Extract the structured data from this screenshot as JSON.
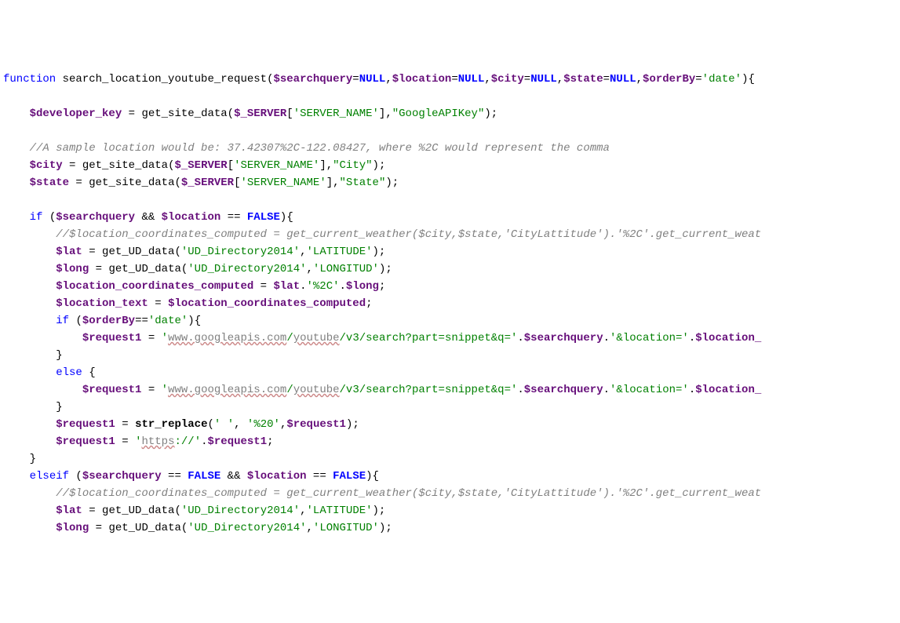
{
  "line1": {
    "kw": "function",
    "fn": " search_location_youtube_request",
    "p1": "(",
    "v1": "$searchquery",
    "eq1": "=",
    "n1": "NULL",
    "c1": ",",
    "v2": "$location",
    "eq2": "=",
    "n2": "NULL",
    "c2": ",",
    "v3": "$city",
    "eq3": "=",
    "n3": "NULL",
    "c3": ",",
    "v4": "$state",
    "eq4": "=",
    "n4": "NULL",
    "c4": ",",
    "v5": "$orderBy",
    "eq5": "=",
    "s": "'date'",
    "p2": "){"
  },
  "line3": {
    "v1": "$developer_key",
    "eq": " = ",
    "fn": "get_site_data",
    "p1": "(",
    "v2": "$_SERVER",
    "br": "[",
    "s1": "'SERVER_NAME'",
    "br2": "],",
    "s2": "\"GoogleAPIKey\"",
    "p2": ");"
  },
  "line5": {
    "c": "//A sample location would be: 37.42307%2C-122.08427, where %2C would represent the comma"
  },
  "line6": {
    "v1": "$city",
    "eq": " = ",
    "fn": "get_site_data",
    "p1": "(",
    "v2": "$_SERVER",
    "br": "[",
    "s1": "'SERVER_NAME'",
    "br2": "],",
    "s2": "\"City\"",
    "p2": ");"
  },
  "line7": {
    "v1": "$state",
    "eq": " = ",
    "fn": "get_site_data",
    "p1": "(",
    "v2": "$_SERVER",
    "br": "[",
    "s1": "'SERVER_NAME'",
    "br2": "],",
    "s2": "\"State\"",
    "p2": ");"
  },
  "line9": {
    "kw": "if ",
    "p1": "(",
    "v1": "$searchquery",
    "op": " && ",
    "v2": "$location",
    "eq": " == ",
    "n": "FALSE",
    "p2": "){"
  },
  "line10": {
    "c": "//$location_coordinates_computed = get_current_weather($city,$state,'CityLattitude').'%2C'.get_current_weat"
  },
  "line11": {
    "v1": "$lat",
    "eq": " = ",
    "fn": "get_UD_data",
    "p1": "(",
    "s1": "'UD_Directory2014'",
    "c": ",",
    "s2": "'LATITUDE'",
    "p2": ");"
  },
  "line12": {
    "v1": "$long",
    "eq": " = ",
    "fn": "get_UD_data",
    "p1": "(",
    "s1": "'UD_Directory2014'",
    "c": ",",
    "s2": "'LONGITUD'",
    "p2": ");"
  },
  "line13": {
    "v1": "$location_coordinates_computed",
    "eq": " = ",
    "v2": "$lat",
    "dot": ".",
    "s": "'%2C'",
    "dot2": ".",
    "v3": "$long",
    "semi": ";"
  },
  "line14": {
    "v1": "$location_text",
    "eq": " = ",
    "v2": "$location_coordinates_computed",
    "semi": ";"
  },
  "line15": {
    "kw": "if ",
    "p1": "(",
    "v1": "$orderBy",
    "eq": "==",
    "s": "'date'",
    "p2": "){"
  },
  "line16": {
    "v1": "$request1",
    "eq": " = ",
    "q1": "'",
    "url1": "www.googleapis.com",
    "sl1": "/",
    "url2": "youtube",
    "s2": "/v3/search?part=snippet&q='",
    "dot": ".",
    "v2": "$searchquery",
    "dot2": ".",
    "s3": "'&location='",
    "dot3": ".",
    "v3": "$location_"
  },
  "line17": {
    "b": "}"
  },
  "line18": {
    "kw": "else ",
    "b": "{"
  },
  "line19": {
    "v1": "$request1",
    "eq": " = ",
    "q1": "'",
    "url1": "www.googleapis.com",
    "sl1": "/",
    "url2": "youtube",
    "s2": "/v3/search?part=snippet&q='",
    "dot": ".",
    "v2": "$searchquery",
    "dot2": ".",
    "s3": "'&location='",
    "dot3": ".",
    "v3": "$location_"
  },
  "line20": {
    "b": "}"
  },
  "line21": {
    "v1": "$request1",
    "eq": " = ",
    "fn": "str_replace",
    "p1": "(",
    "s1": "' '",
    "c1": ", ",
    "s2": "'%20'",
    "c2": ",",
    "v2": "$request1",
    "p2": ");"
  },
  "line22": {
    "v1": "$request1",
    "eq": " = ",
    "q1": "'",
    "url": "https",
    "s": "://'",
    "dot": ".",
    "v2": "$request1",
    "semi": ";"
  },
  "line23": {
    "b": "}"
  },
  "line24": {
    "kw": "elseif ",
    "p1": "(",
    "v1": "$searchquery",
    "eq1": " == ",
    "n1": "FALSE",
    "op": " && ",
    "v2": "$location",
    "eq2": " == ",
    "n2": "FALSE",
    "p2": "){"
  },
  "line25": {
    "c": "//$location_coordinates_computed = get_current_weather($city,$state,'CityLattitude').'%2C'.get_current_weat"
  },
  "line26": {
    "v1": "$lat",
    "eq": " = ",
    "fn": "get_UD_data",
    "p1": "(",
    "s1": "'UD_Directory2014'",
    "c": ",",
    "s2": "'LATITUDE'",
    "p2": ");"
  },
  "line27": {
    "v1": "$long",
    "eq": " = ",
    "fn": "get_UD_data",
    "p1": "(",
    "s1": "'UD_Directory2014'",
    "c": ",",
    "s2": "'LONGITUD'",
    "p2": ");"
  }
}
